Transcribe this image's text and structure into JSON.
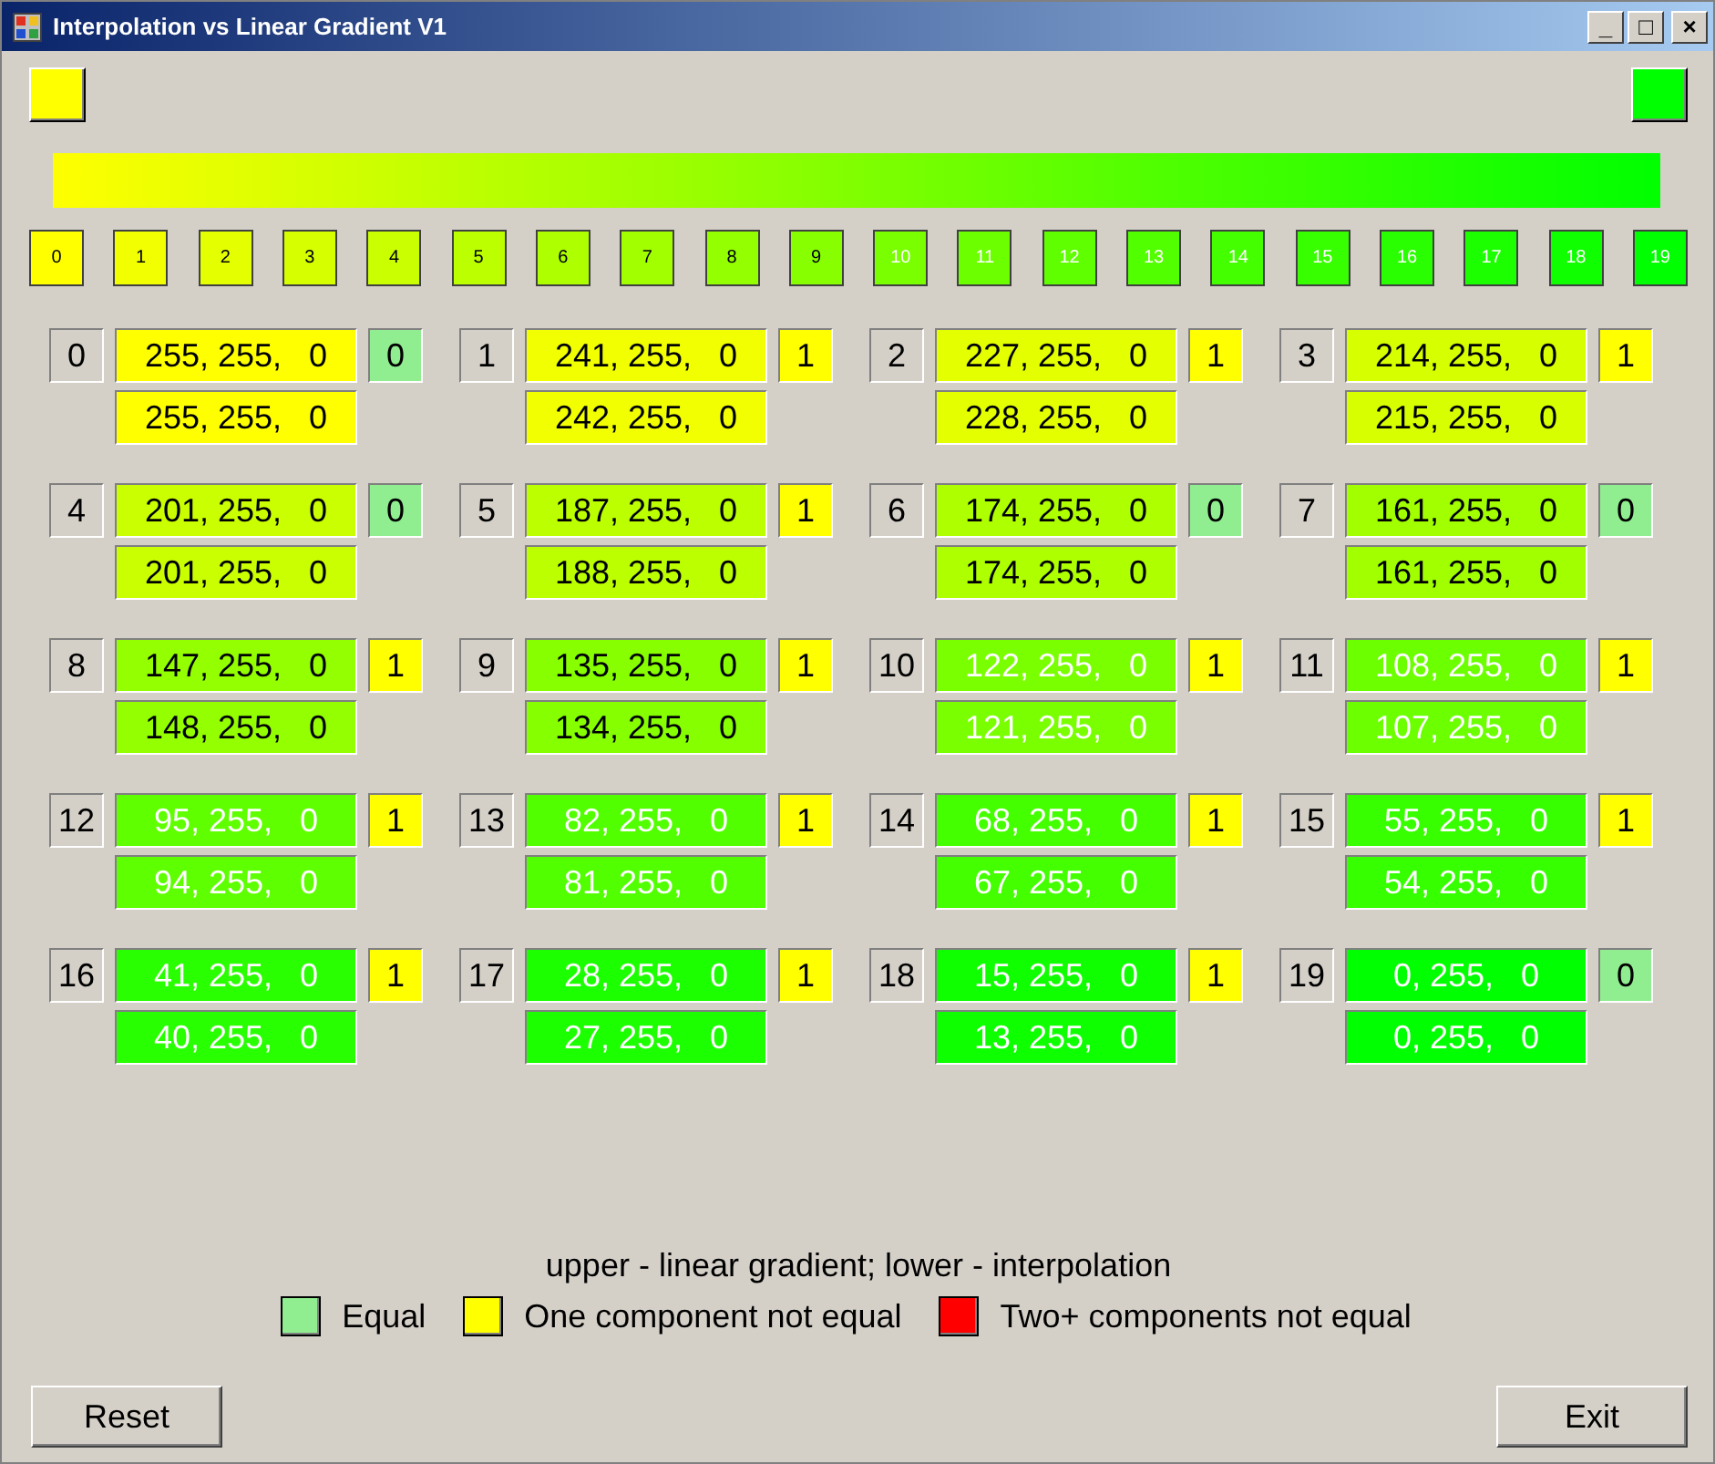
{
  "window": {
    "title": "Interpolation vs Linear Gradient V1",
    "controls": [
      "_",
      "□",
      "×"
    ]
  },
  "start_swatch": {
    "color": "#ffff00"
  },
  "end_swatch": {
    "color": "#00ff00"
  },
  "swatches": [
    {
      "label": "0",
      "color": "#ffff00"
    },
    {
      "label": "1",
      "color": "#f1ff00"
    },
    {
      "label": "2",
      "color": "#e3ff00"
    },
    {
      "label": "3",
      "color": "#d6ff00"
    },
    {
      "label": "4",
      "color": "#c9ff00"
    },
    {
      "label": "5",
      "color": "#bbff00"
    },
    {
      "label": "6",
      "color": "#aeff00"
    },
    {
      "label": "7",
      "color": "#a1ff00"
    },
    {
      "label": "8",
      "color": "#93ff00"
    },
    {
      "label": "9",
      "color": "#87ff00"
    },
    {
      "label": "10",
      "color": "#7aff00"
    },
    {
      "label": "11",
      "color": "#6cff00"
    },
    {
      "label": "12",
      "color": "#5fff00"
    },
    {
      "label": "13",
      "color": "#52ff00"
    },
    {
      "label": "14",
      "color": "#44ff00"
    },
    {
      "label": "15",
      "color": "#37ff00"
    },
    {
      "label": "16",
      "color": "#29ff00"
    },
    {
      "label": "17",
      "color": "#1cff00"
    },
    {
      "label": "18",
      "color": "#0fff00"
    },
    {
      "label": "19",
      "color": "#00ff00"
    }
  ],
  "cells": [
    {
      "index": "0",
      "upper": {
        "text": "255, 255,   0",
        "color": "#ffff00"
      },
      "lower": {
        "text": "255, 255,   0",
        "color": "#ffff00"
      },
      "diff": {
        "text": "0",
        "color": "#90ee90"
      }
    },
    {
      "index": "1",
      "upper": {
        "text": "241, 255,   0",
        "color": "#f1ff00"
      },
      "lower": {
        "text": "242, 255,   0",
        "color": "#f2ff00"
      },
      "diff": {
        "text": "1",
        "color": "#ffff00"
      }
    },
    {
      "index": "2",
      "upper": {
        "text": "227, 255,   0",
        "color": "#e3ff00"
      },
      "lower": {
        "text": "228, 255,   0",
        "color": "#e4ff00"
      },
      "diff": {
        "text": "1",
        "color": "#ffff00"
      }
    },
    {
      "index": "3",
      "upper": {
        "text": "214, 255,   0",
        "color": "#d6ff00"
      },
      "lower": {
        "text": "215, 255,   0",
        "color": "#d7ff00"
      },
      "diff": {
        "text": "1",
        "color": "#ffff00"
      }
    },
    {
      "index": "4",
      "upper": {
        "text": "201, 255,   0",
        "color": "#c9ff00"
      },
      "lower": {
        "text": "201, 255,   0",
        "color": "#c9ff00"
      },
      "diff": {
        "text": "0",
        "color": "#90ee90"
      }
    },
    {
      "index": "5",
      "upper": {
        "text": "187, 255,   0",
        "color": "#bbff00"
      },
      "lower": {
        "text": "188, 255,   0",
        "color": "#bcff00"
      },
      "diff": {
        "text": "1",
        "color": "#ffff00"
      }
    },
    {
      "index": "6",
      "upper": {
        "text": "174, 255,   0",
        "color": "#aeff00"
      },
      "lower": {
        "text": "174, 255,   0",
        "color": "#aeff00"
      },
      "diff": {
        "text": "0",
        "color": "#90ee90"
      }
    },
    {
      "index": "7",
      "upper": {
        "text": "161, 255,   0",
        "color": "#a1ff00"
      },
      "lower": {
        "text": "161, 255,   0",
        "color": "#a1ff00"
      },
      "diff": {
        "text": "0",
        "color": "#90ee90"
      }
    },
    {
      "index": "8",
      "upper": {
        "text": "147, 255,   0",
        "color": "#93ff00"
      },
      "lower": {
        "text": "148, 255,   0",
        "color": "#94ff00"
      },
      "diff": {
        "text": "1",
        "color": "#ffff00"
      }
    },
    {
      "index": "9",
      "upper": {
        "text": "135, 255,   0",
        "color": "#87ff00"
      },
      "lower": {
        "text": "134, 255,   0",
        "color": "#86ff00"
      },
      "diff": {
        "text": "1",
        "color": "#ffff00"
      }
    },
    {
      "index": "10",
      "upper": {
        "text": "122, 255,   0",
        "color": "#7aff00"
      },
      "lower": {
        "text": "121, 255,   0",
        "color": "#79ff00"
      },
      "diff": {
        "text": "1",
        "color": "#ffff00"
      }
    },
    {
      "index": "11",
      "upper": {
        "text": "108, 255,   0",
        "color": "#6cff00"
      },
      "lower": {
        "text": "107, 255,   0",
        "color": "#6bff00"
      },
      "diff": {
        "text": "1",
        "color": "#ffff00"
      }
    },
    {
      "index": "12",
      "upper": {
        "text": "95, 255,   0",
        "color": "#5fff00"
      },
      "lower": {
        "text": "94, 255,   0",
        "color": "#5eff00"
      },
      "diff": {
        "text": "1",
        "color": "#ffff00"
      }
    },
    {
      "index": "13",
      "upper": {
        "text": "82, 255,   0",
        "color": "#52ff00"
      },
      "lower": {
        "text": "81, 255,   0",
        "color": "#51ff00"
      },
      "diff": {
        "text": "1",
        "color": "#ffff00"
      }
    },
    {
      "index": "14",
      "upper": {
        "text": "68, 255,   0",
        "color": "#44ff00"
      },
      "lower": {
        "text": "67, 255,   0",
        "color": "#43ff00"
      },
      "diff": {
        "text": "1",
        "color": "#ffff00"
      }
    },
    {
      "index": "15",
      "upper": {
        "text": "55, 255,   0",
        "color": "#37ff00"
      },
      "lower": {
        "text": "54, 255,   0",
        "color": "#36ff00"
      },
      "diff": {
        "text": "1",
        "color": "#ffff00"
      }
    },
    {
      "index": "16",
      "upper": {
        "text": "41, 255,   0",
        "color": "#29ff00"
      },
      "lower": {
        "text": "40, 255,   0",
        "color": "#28ff00"
      },
      "diff": {
        "text": "1",
        "color": "#ffff00"
      }
    },
    {
      "index": "17",
      "upper": {
        "text": "28, 255,   0",
        "color": "#1cff00"
      },
      "lower": {
        "text": "27, 255,   0",
        "color": "#1bff00"
      },
      "diff": {
        "text": "1",
        "color": "#ffff00"
      }
    },
    {
      "index": "18",
      "upper": {
        "text": "15, 255,   0",
        "color": "#0fff00"
      },
      "lower": {
        "text": "13, 255,   0",
        "color": "#0dff00"
      },
      "diff": {
        "text": "1",
        "color": "#ffff00"
      }
    },
    {
      "index": "19",
      "upper": {
        "text": "0, 255,   0",
        "color": "#00ff00"
      },
      "lower": {
        "text": "0, 255,   0",
        "color": "#00ff00"
      },
      "diff": {
        "text": "0",
        "color": "#90ee90"
      }
    }
  ],
  "caption": "upper - linear gradient; lower - interpolation",
  "legend": [
    {
      "label": "Equal",
      "color": "#90ee90"
    },
    {
      "label": "One component not equal",
      "color": "#ffff00"
    },
    {
      "label": "Two+ components not equal",
      "color": "#ff0000"
    }
  ],
  "buttons": {
    "left": "Reset",
    "right": "Exit"
  }
}
